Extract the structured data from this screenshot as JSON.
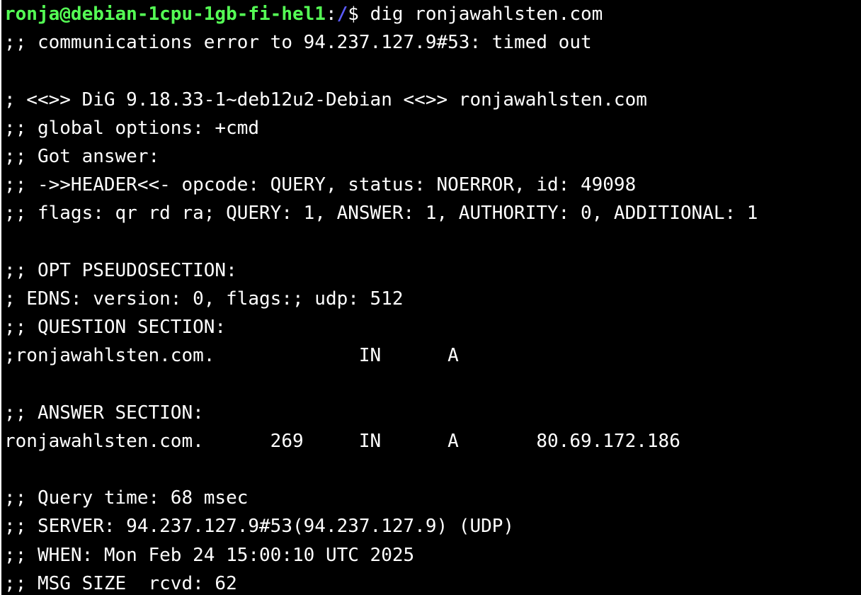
{
  "prompt": {
    "user_host": "ronja@debian-1cpu-1gb-fi-hel1",
    "sep": ":",
    "path": "/",
    "dollar": "$ ",
    "command": "dig ronjawahlsten.com"
  },
  "output": [
    ";; communications error to 94.237.127.9#53: timed out",
    "",
    "; <<>> DiG 9.18.33-1~deb12u2-Debian <<>> ronjawahlsten.com",
    ";; global options: +cmd",
    ";; Got answer:",
    ";; ->>HEADER<<- opcode: QUERY, status: NOERROR, id: 49098",
    ";; flags: qr rd ra; QUERY: 1, ANSWER: 1, AUTHORITY: 0, ADDITIONAL: 1",
    "",
    ";; OPT PSEUDOSECTION:",
    "; EDNS: version: 0, flags:; udp: 512",
    ";; QUESTION SECTION:",
    ";ronjawahlsten.com.             IN      A",
    "",
    ";; ANSWER SECTION:",
    "ronjawahlsten.com.      269     IN      A       80.69.172.186",
    "",
    ";; Query time: 68 msec",
    ";; SERVER: 94.237.127.9#53(94.237.127.9) (UDP)",
    ";; WHEN: Mon Feb 24 15:00:10 UTC 2025",
    ";; MSG SIZE  rcvd: 62"
  ]
}
